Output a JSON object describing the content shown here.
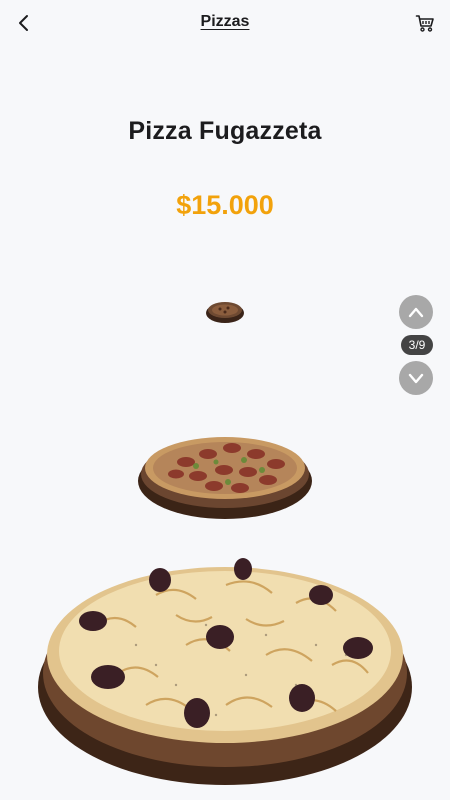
{
  "header": {
    "title": "Pizzas",
    "back_icon": "chevron-left-icon",
    "cart_icon": "cart-icon"
  },
  "product": {
    "name": "Pizza Fugazzeta",
    "price": "$15.000"
  },
  "carousel": {
    "counter": "3/9",
    "up_icon": "chevron-up-icon",
    "down_icon": "chevron-down-icon"
  },
  "colors": {
    "price": "#f2a20b",
    "nav_button": "#a8a8a8",
    "counter_bg": "#444444",
    "background": "#f7f8fa"
  }
}
